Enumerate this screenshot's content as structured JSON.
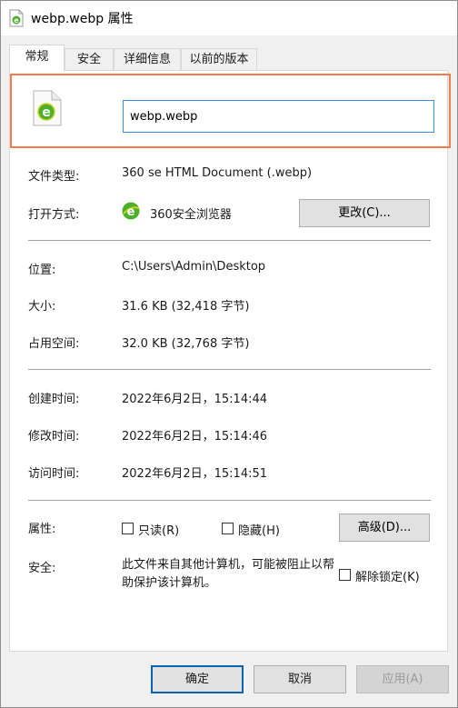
{
  "window": {
    "title": "webp.webp 属性"
  },
  "tabs": [
    {
      "label": "常规"
    },
    {
      "label": "安全"
    },
    {
      "label": "详细信息"
    },
    {
      "label": "以前的版本"
    }
  ],
  "file": {
    "name": "webp.webp"
  },
  "general": {
    "type_label": "文件类型:",
    "type_value": "360 se HTML Document (.webp)",
    "opens_label": "打开方式:",
    "opens_value": "360安全浏览器",
    "change_button": "更改(C)...",
    "location_label": "位置:",
    "location_value": "C:\\Users\\Admin\\Desktop",
    "size_label": "大小:",
    "size_value": "31.6 KB (32,418 字节)",
    "disk_label": "占用空间:",
    "disk_value": "32.0 KB (32,768 字节)",
    "created_label": "创建时间:",
    "created_value": "2022年6月2日，15:14:44",
    "modified_label": "修改时间:",
    "modified_value": "2022年6月2日，15:14:46",
    "accessed_label": "访问时间:",
    "accessed_value": "2022年6月2日，15:14:51",
    "attributes_label": "属性:",
    "readonly_label": "只读(R)",
    "hidden_label": "隐藏(H)",
    "advanced_button": "高级(D)...",
    "security_label": "安全:",
    "security_text": "此文件来自其他计算机，可能被阻止以帮助保护该计算机。",
    "unblock_label": "解除锁定(K)"
  },
  "footer": {
    "ok": "确定",
    "cancel": "取消",
    "apply": "应用(A)"
  },
  "colors": {
    "highlight": "#f07c4c",
    "input_border": "#3c8fd8",
    "ie_green": "#4caf2a"
  }
}
